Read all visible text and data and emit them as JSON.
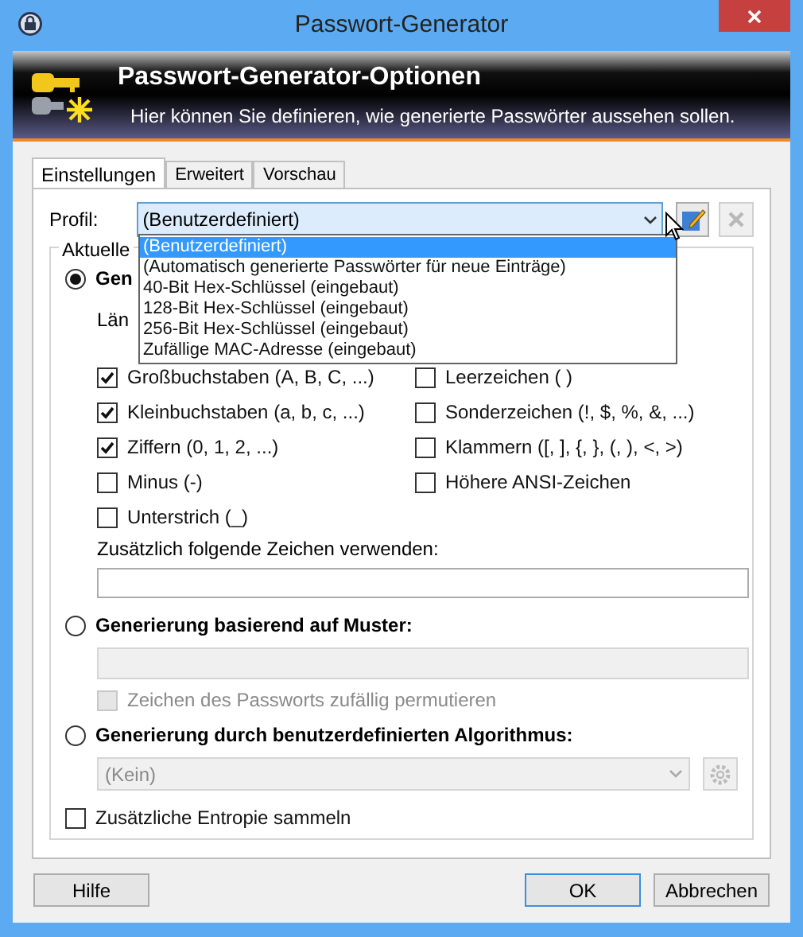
{
  "window": {
    "title": "Passwort-Generator"
  },
  "banner": {
    "title": "Passwort-Generator-Optionen",
    "subtitle": "Hier können Sie definieren, wie generierte Passwörter aussehen sollen."
  },
  "tabs": [
    {
      "label": "Einstellungen",
      "selected": true
    },
    {
      "label": "Erweitert",
      "selected": false
    },
    {
      "label": "Vorschau",
      "selected": false
    }
  ],
  "profile": {
    "label": "Profil:",
    "value": "(Benutzerdefiniert)",
    "expanded": true,
    "options": [
      {
        "label": "(Benutzerdefiniert)",
        "selected": true
      },
      {
        "label": "(Automatisch generierte Passwörter für neue Einträge)",
        "selected": false
      },
      {
        "label": "40-Bit Hex-Schlüssel (eingebaut)",
        "selected": false
      },
      {
        "label": "128-Bit Hex-Schlüssel (eingebaut)",
        "selected": false
      },
      {
        "label": "256-Bit Hex-Schlüssel (eingebaut)",
        "selected": false
      },
      {
        "label": "Zufällige MAC-Adresse (eingebaut)",
        "selected": false
      }
    ]
  },
  "group": {
    "label": "Aktuelle"
  },
  "charset_mode": {
    "label": "Gen",
    "selected": true,
    "length_label": "Län",
    "left_options": [
      {
        "label": "Großbuchstaben (A, B, C, ...)",
        "checked": true
      },
      {
        "label": "Kleinbuchstaben (a, b, c, ...)",
        "checked": true
      },
      {
        "label": "Ziffern (0, 1, 2, ...)",
        "checked": true
      },
      {
        "label": "Minus (-)",
        "checked": false
      },
      {
        "label": "Unterstrich (_)",
        "checked": false
      }
    ],
    "right_options": [
      {
        "label": "Leerzeichen ( )",
        "checked": false
      },
      {
        "label": "Sonderzeichen (!, $, %, &, ...)",
        "checked": false
      },
      {
        "label": "Klammern ([, ], {, }, (, ), <, >)",
        "checked": false
      },
      {
        "label": "Höhere ANSI-Zeichen",
        "checked": false
      }
    ],
    "extra_label": "Zusätzlich folgende Zeichen verwenden:"
  },
  "pattern_mode": {
    "label": "Generierung basierend auf Muster:",
    "selected": false,
    "permute": {
      "label": "Zeichen des Passworts zufällig permutieren",
      "checked": false,
      "disabled": true
    }
  },
  "algorithm_mode": {
    "label": "Generierung durch benutzerdefinierten Algorithmus:",
    "selected": false,
    "value": "(Kein)",
    "disabled": true
  },
  "entropy": {
    "label": "Zusätzliche Entropie sammeln",
    "checked": false
  },
  "buttons": [
    {
      "label": "Hilfe",
      "default": false
    },
    {
      "label": "OK",
      "default": true
    },
    {
      "label": "Abbrechen",
      "default": false
    }
  ]
}
